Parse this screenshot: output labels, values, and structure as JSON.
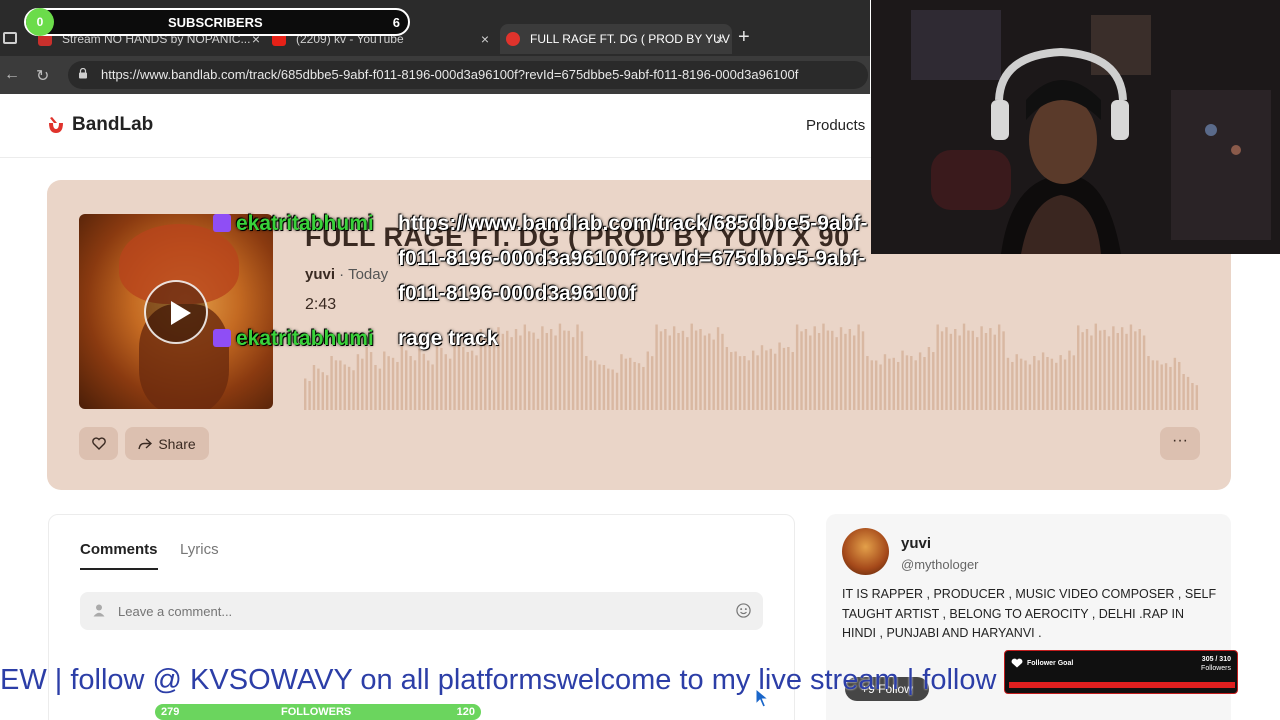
{
  "browser": {
    "tabs": [
      {
        "label": "Stream NO HANDS by NOPANIC...",
        "active": false
      },
      {
        "label": "(2209) kv - YouTube",
        "active": false
      },
      {
        "label": "FULL RAGE FT. DG ( PROD BY YUV",
        "active": true
      }
    ],
    "url": "https://www.bandlab.com/track/685dbbe5-9abf-f011-8196-000d3a96100f?revId=675dbbe5-9abf-f011-8196-000d3a96100f"
  },
  "site": {
    "logo": "BandLab",
    "nav_products": "Products"
  },
  "track": {
    "title": "FULL RAGE FT. DG ( PROD BY YUVI X 90",
    "artist": "yuvi",
    "when": " · Today",
    "duration": "2:43",
    "share_label": "Share",
    "more_label": "···",
    "waveform_levels": [
      0.35,
      0.5,
      0.42,
      0.6,
      0.55,
      0.48,
      0.62,
      0.7,
      0.5,
      0.65,
      0.58,
      0.72,
      0.6,
      0.68,
      0.55,
      0.75,
      0.62,
      0.8,
      0.7,
      0.66,
      0.9,
      0.85,
      0.92,
      0.88,
      0.9,
      0.95,
      0.86,
      0.93,
      0.9,
      0.96,
      0.88,
      0.95,
      0.6,
      0.55,
      0.5,
      0.45,
      0.62,
      0.58,
      0.52,
      0.65,
      0.95,
      0.9,
      0.93,
      0.88,
      0.96,
      0.9,
      0.85,
      0.92,
      0.7,
      0.65,
      0.6,
      0.66,
      0.72,
      0.68,
      0.75,
      0.7,
      0.95,
      0.9,
      0.93,
      0.96,
      0.88,
      0.92,
      0.9,
      0.95,
      0.6,
      0.55,
      0.62,
      0.58,
      0.66,
      0.6,
      0.64,
      0.7,
      0.95,
      0.92,
      0.9,
      0.96,
      0.88,
      0.93,
      0.91,
      0.95,
      0.58,
      0.62,
      0.55,
      0.6,
      0.64,
      0.57,
      0.61,
      0.66,
      0.94,
      0.9,
      0.96,
      0.89,
      0.93,
      0.92,
      0.95,
      0.9,
      0.6,
      0.55,
      0.52,
      0.58,
      0.4,
      0.3
    ]
  },
  "comments": {
    "tab_comments": "Comments",
    "tab_lyrics": "Lyrics",
    "placeholder": "Leave a comment..."
  },
  "profile": {
    "name": "yuvi",
    "handle": "@mythologer",
    "bio": "IT IS RAPPER , PRODUCER , MUSIC VIDEO COMPOSER , SELF TAUGHT ARTIST , BELONG TO AEROCITY , DELHI .RAP IN HINDI , PUNJABI AND HARYANVI ."
  },
  "overlay": {
    "subs_current": "0",
    "subs_label": "SUBSCRIBERS",
    "subs_goal": "6",
    "chat": [
      {
        "user": "ekatritabhumi",
        "line1": "https://www.bandlab.com/track/685dbbe5-9abf-",
        "line2": "f011-8196-000d3a96100f?revId=675dbbe5-9abf-",
        "line3": "f011-8196-000d3a96100f"
      },
      {
        "user": "ekatritabhumi",
        "line1": "rage track"
      }
    ],
    "ticker": "EW  | follow @ KVSOWAVY on all platformswelcome to my live stream | follow @ KVSOWAVY R",
    "followers_left": "279",
    "followers_label": "FOLLOWERS",
    "followers_right": "120",
    "follower_goal_title": "Follower Goal",
    "follower_goal_value": "305 / 310",
    "follower_goal_unit": "Followers",
    "follow_pill": "+9 Follow"
  },
  "colors": {
    "card": "#ead5c8",
    "accent_red": "#e0332c",
    "green": "#39d23a",
    "ticker": "#2c3ea7"
  }
}
